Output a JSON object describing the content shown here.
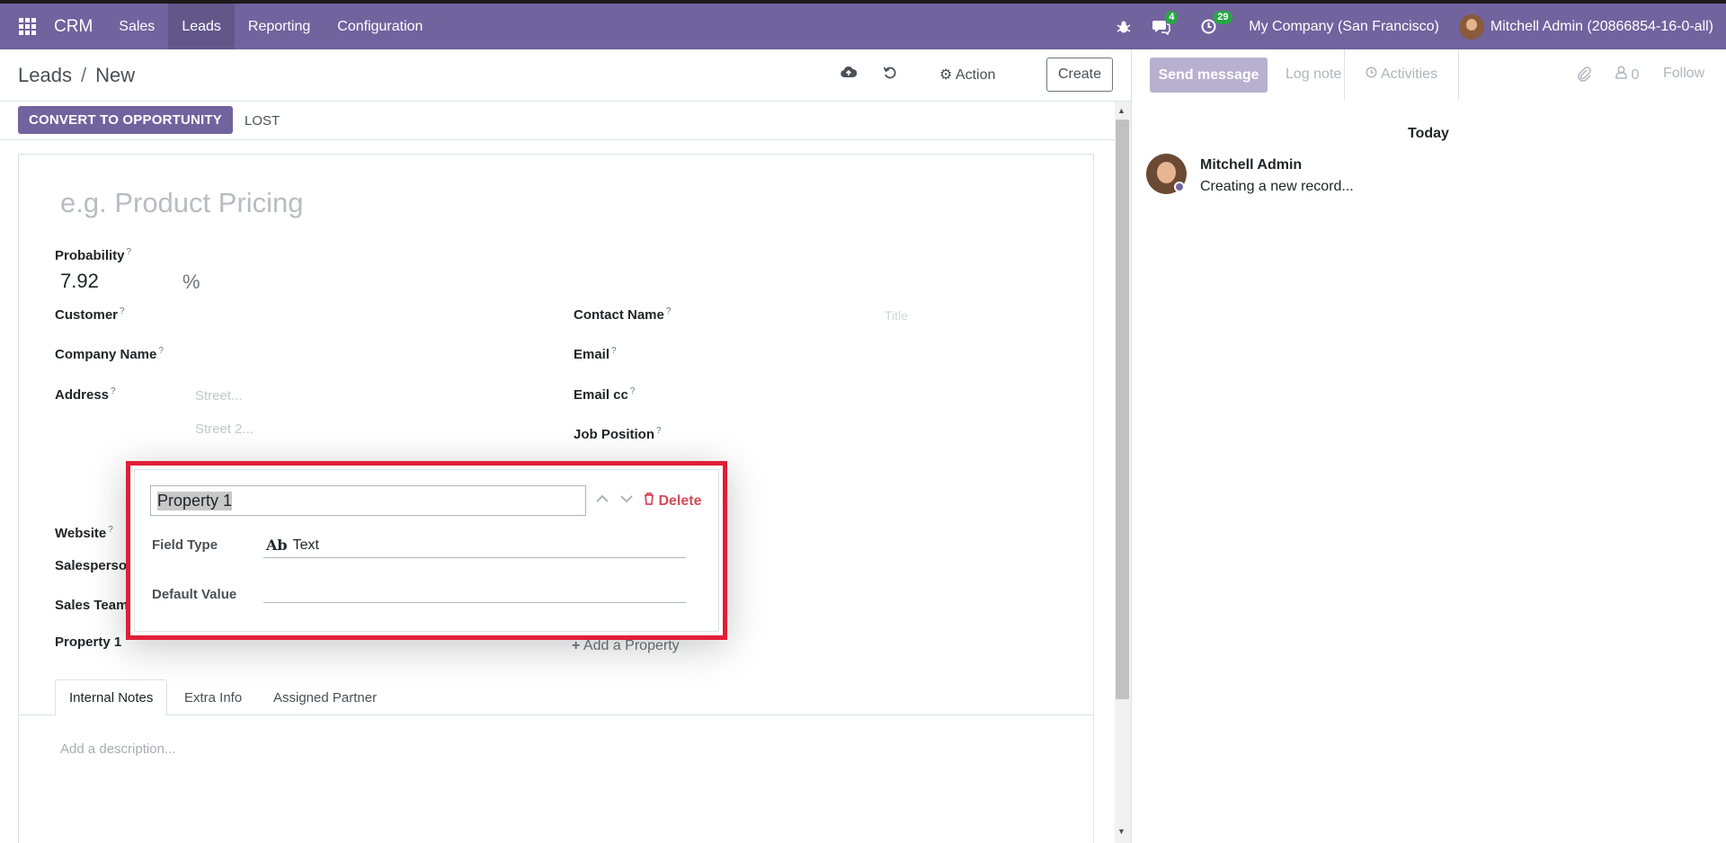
{
  "navbar": {
    "brand": "CRM",
    "menu": [
      "Sales",
      "Leads",
      "Reporting",
      "Configuration"
    ],
    "messages_count": "4",
    "activities_count": "29",
    "company": "My Company (San Francisco)",
    "user": "Mitchell Admin (20866854-16-0-all)"
  },
  "control": {
    "breadcrumb_parent": "Leads",
    "breadcrumb_current": "New",
    "action_label": "Action",
    "create_label": "Create"
  },
  "statusbar": {
    "convert_label": "CONVERT TO OPPORTUNITY",
    "lost_label": "LOST"
  },
  "form": {
    "title_placeholder": "e.g. Product Pricing",
    "probability_label": "Probability",
    "probability_value": "7.92",
    "percent_sign": "%",
    "customer_label": "Customer",
    "company_name_label": "Company Name",
    "address_label": "Address",
    "street_placeholder": "Street...",
    "street2_placeholder": "Street 2...",
    "website_label": "Website",
    "salesperson_label": "Salesperson",
    "sales_team_label": "Sales Team",
    "property_label": "Property 1",
    "contact_name_label": "Contact Name",
    "title_field_placeholder": "Title",
    "email_label": "Email",
    "email_cc_label": "Email cc",
    "job_position_label": "Job Position",
    "add_property_label": "Add a Property",
    "help_mark": "?",
    "tabs": [
      "Internal Notes",
      "Extra Info",
      "Assigned Partner"
    ],
    "description_placeholder": "Add a description..."
  },
  "popover": {
    "property_name": "Property 1",
    "delete_label": "Delete",
    "field_type_label": "Field Type",
    "field_type_icon_text": "Ab",
    "field_type_value": "Text",
    "default_value_label": "Default Value",
    "default_value": ""
  },
  "chatter": {
    "send_message_label": "Send message",
    "log_note_label": "Log note",
    "activities_label": "Activities",
    "followers_count": "0",
    "follow_label": "Follow",
    "date_separator": "Today",
    "message_author": "Mitchell Admin",
    "message_body": "Creating a new record..."
  }
}
